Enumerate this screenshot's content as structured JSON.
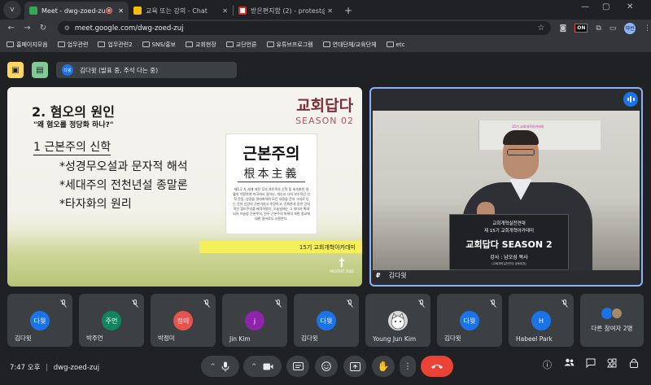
{
  "browser": {
    "tab_menu": "v",
    "tabs": [
      {
        "title": "Meet - dwg-zoed-zuj",
        "active": true,
        "favicon": "#34a853"
      },
      {
        "title": "교육 또는 강의 - Chat",
        "active": false,
        "favicon": "#ea4335"
      },
      {
        "title": "받은편지함 (2) - protest@prot",
        "active": false,
        "favicon": "#d93025"
      }
    ],
    "window_controls": [
      "—",
      "▢",
      "✕"
    ],
    "url": "meet.google.com/dwg-zoed-zuj",
    "on_badge": "ON",
    "profile": "마빈",
    "bookmarks": [
      "홈페이지모음",
      "업무관련",
      "업무관련2",
      "SNS/홍보",
      "교회현장",
      "교단언론",
      "유튜브프로그램",
      "연대단체/교육단체",
      "etc"
    ]
  },
  "meet": {
    "presenter_label": "김다윗 (발표 중, 주석 다는 중)",
    "presenter_avatar": "다윗",
    "slide": {
      "brand_main": "교회답다",
      "brand_sub": "SEASON 02",
      "heading": "2. 혐오의 원인",
      "subquestion": "\"왜 혐오를 정당화 하나?\"",
      "point": "1 근본주의 신학",
      "bullets": [
        "*성경무오설과 문자적 해석",
        "*세대주의 전천년설 종말론",
        "*타자화의 원리"
      ],
      "book_title": "근본주의",
      "book_hanja": "根本主義",
      "book_desc": "제1.2 차 세계 대전 후의 자유주의 신학 및 세속화된 생활의 이탈하여 미국에서 일어난, 개신교 나의 보수적인 신학 운동. 성경을 절대화하여 모든 내용을 문자 그대로 믿는 것이 신앙의 근본이라고 주장하고, 진화론과 같은 근대적인 합리주의를 배격하였다. 오늘날에는 그 의미가 확대되어 이슬람 근본주의, 힌두 근본주의 따위의 좌편 종교에 대한 용어로도 사용한다.",
      "banner": "15기 교회개혁아카데미",
      "logo_text": "†",
      "logo_caption": "PROTEST 2002"
    },
    "speaker": {
      "name": "김다윗",
      "screen_text": "15기 교회개혁아카데미",
      "podium_line1": "교회개혁실천연대",
      "podium_line2": "제 15기 교회개혁아카데미",
      "podium_title": "교회답다 SEASON 2",
      "podium_speaker": "강사 : 남오성 목사",
      "podium_small": "(교회개혁실천연대 공동대표)"
    },
    "participants": [
      {
        "name": "김다윗",
        "initials": "다윗",
        "color": "#1a73e8"
      },
      {
        "name": "박주언",
        "initials": "주언",
        "color": "#12855f"
      },
      {
        "name": "박정미",
        "initials": "정미",
        "color": "#e5544f"
      },
      {
        "name": "Jin Kim",
        "initials": "j",
        "color": "#8e24aa"
      },
      {
        "name": "김다윗",
        "initials": "다윗",
        "color": "#1a73e8"
      },
      {
        "name": "Young Jun Kim",
        "initials": "",
        "color": "#d9d9d9"
      },
      {
        "name": "김다윗",
        "initials": "다윗",
        "color": "#1a73e8"
      },
      {
        "name": "Habeel Park",
        "initials": "H",
        "color": "#1a73e8"
      },
      {
        "name": "다른 참여자 2명",
        "initials": "",
        "color": "#1a73e8"
      }
    ],
    "clock": "7:47 오후",
    "meeting_code": "dwg-zoed-zuj",
    "colors": {
      "end_call": "#ea4335",
      "accent": "#8ab4f8",
      "tile": "#3c4043"
    }
  }
}
